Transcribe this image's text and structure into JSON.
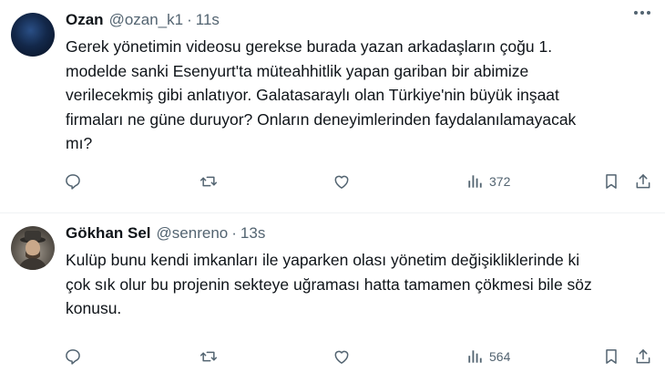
{
  "tweets": [
    {
      "name": "Ozan",
      "handle": "@ozan_k1",
      "separator": "·",
      "time": "11s",
      "text": "Gerek yönetimin videosu gerekse burada yazan arkadaşların çoğu 1.\nmodelde sanki Esenyurt'ta müteahhitlik yapan gariban bir abimize\nverilecekmiş gibi anlatıyor. Galatasaraylı olan Türkiye'nin büyük inşaat\nfirmaları ne güne duruyor? Onların deneyimlerinden faydalanılamayacak\nmı?",
      "views": "372"
    },
    {
      "name": "Gökhan Sel",
      "handle": "@senreno",
      "separator": "·",
      "time": "13s",
      "text": "Kulüp bunu kendi imkanları ile yaparken olası yönetim değişikliklerinde ki\nçok sık olur bu projenin sekteye uğraması hatta tamamen çökmesi bile söz\nkonusu.",
      "views": "564"
    }
  ],
  "icons": {
    "reply": "reply-icon",
    "retweet": "retweet-icon",
    "like": "heart-icon",
    "views": "views-icon",
    "bookmark": "bookmark-icon",
    "share": "share-icon",
    "more": "more-icon"
  },
  "colors": {
    "text": "#0f1419",
    "secondary": "#536471",
    "divider": "#eff3f4"
  }
}
